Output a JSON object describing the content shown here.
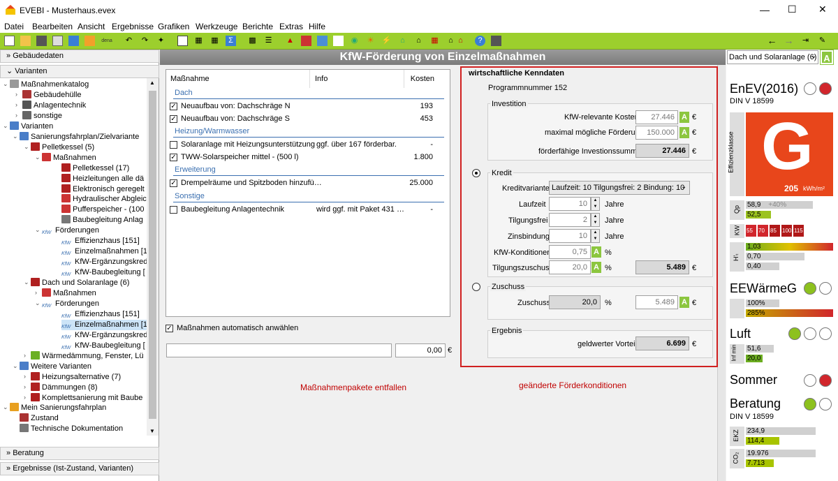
{
  "app": {
    "title": "EVEBI - Musterhaus.evex"
  },
  "menu": [
    "Datei",
    "Bearbeiten",
    "Ansicht",
    "Ergebnisse",
    "Grafiken",
    "Werkzeuge",
    "Berichte",
    "Extras",
    "Hilfe"
  ],
  "toolbar": {
    "dena_label": "dena"
  },
  "left": {
    "gebaeudedaten": "Gebäudedaten",
    "varianten": "Varianten",
    "beratung": "Beratung",
    "ergebnisse": "Ergebnisse (Ist-Zustand, Varianten)",
    "tree": [
      "Maßnahmenkatalog",
      "Gebäudehülle",
      "Anlagentechnik",
      "sonstige",
      "Varianten",
      "Sanierungsfahrplan/Zielvariante",
      "Pelletkessel (5)",
      "Maßnahmen",
      "Pelletkessel (17)",
      "Heizleitungen alle dä",
      "Elektronisch geregelt",
      "Hydraulischer Abgleic",
      "Pufferspeicher - (100",
      "Baubegleitung Anlag",
      "Förderungen",
      "Effizienzhaus [151]",
      "Einzelmaßnahmen [1",
      "KfW-Ergänzungskred",
      "KfW-Baubegleitung [",
      "Dach und Solaranlage (6)",
      "Maßnahmen",
      "Förderungen",
      "Effizienzhaus [151]",
      "Einzelmaßnahmen [1",
      "KfW-Ergänzungskred",
      "KfW-Baubegleitung [",
      "Wärmedämmung, Fenster, Lü",
      "Weitere Varianten",
      "Heizungsalternative (7)",
      "Dämmungen (8)",
      "Komplettsanierung mit Baube",
      "Mein Sanierungsfahrplan",
      "Zustand",
      "Technische Dokumentation"
    ],
    "kfw_tag": "KfW"
  },
  "center": {
    "title": "KfW-Förderung von Einzelmaßnahmen",
    "list_headers": {
      "massnahme": "Maßnahme",
      "info": "Info",
      "kosten": "Kosten"
    },
    "groups": [
      {
        "name": "Dach",
        "items": [
          {
            "label": "Neuaufbau von: Dachschräge N",
            "info": "",
            "cost": "193",
            "checked": true
          },
          {
            "label": "Neuaufbau von: Dachschräge S",
            "info": "",
            "cost": "453",
            "checked": true
          }
        ]
      },
      {
        "name": "Heizung/Warmwasser",
        "items": [
          {
            "label": "Solaranlage mit Heizungsunterstützung",
            "info": "ggf. über 167 förderbar.",
            "cost": "-",
            "checked": false
          },
          {
            "label": "TWW-Solarspeicher mittel - (500 l)",
            "info": "",
            "cost": "1.800",
            "checked": true
          }
        ]
      },
      {
        "name": "Erweiterung",
        "items": [
          {
            "label": "Drempelräume und Spitzboden hinzufü…",
            "info": "",
            "cost": "25.000",
            "checked": true
          }
        ]
      },
      {
        "name": "Sonstige",
        "items": [
          {
            "label": "Baubegleitung Anlagentechnik",
            "info": "wird ggf. mit Paket 431 …",
            "cost": "-",
            "checked": false
          }
        ]
      }
    ],
    "auto_select_label": "Maßnahmen automatisch anwählen",
    "sum_value": "0,00",
    "euro": "€",
    "note_left": "Maßnahmenpakete entfallen",
    "note_right": "geänderte Förderkonditionen",
    "kenn": {
      "title": "wirtschaftliche Kenndaten",
      "programm": "Programmnummer 152",
      "investition_legend": "Investition",
      "kfw_kosten_label": "KfW-relevante Kosten",
      "kfw_kosten_value": "27.446",
      "max_foerderung_label": "maximal mögliche Förderung",
      "max_foerderung_value": "150.000",
      "foerderfaehig_label": "förderfähige Investionssumme",
      "foerderfaehig_value": "27.446",
      "kredit_legend": "Kredit",
      "kreditvariante_label": "Kreditvariante",
      "kreditvariante_value": "Laufzeit: 10 Tilgungsfrei: 2 Bindung: 10",
      "laufzeit_label": "Laufzeit",
      "laufzeit_value": "10",
      "tilgungsfrei_label": "Tilgungsfrei",
      "tilgungsfrei_value": "2",
      "zinsbindung_label": "Zinsbindung",
      "zinsbindung_value": "10",
      "jahre": "Jahre",
      "konditionen_label": "KfW-Konditionen",
      "konditionen_value": "0,75",
      "tilgungszuschuss_label": "Tilgungszuschuss",
      "tilgungszuschuss_value": "20,0",
      "tilgungszuschuss_result": "5.489",
      "percent": "%",
      "zuschuss_legend": "Zuschuss",
      "zuschuss_label": "Zuschuss",
      "zuschuss_value": "20,0",
      "zuschuss_result": "5.489",
      "ergebnis_legend": "Ergebnis",
      "geldwert_label": "geldwerter Vorteil",
      "geldwert_value": "6.699"
    }
  },
  "right": {
    "dropdown": "Dach und Solaranlage (6)",
    "enev_title": "EnEV(2016)",
    "din1": "DIN V 18599",
    "effizienz_label": "Effizienzklasse",
    "grade": "G",
    "kwh": "205",
    "kwh_unit": "kWh/m²",
    "qp_label": "Qp",
    "qp_bar1": "58,9",
    "qp_pct": "+40%",
    "qp_bar2": "52,5",
    "kw_label": "KW",
    "kw_values": [
      "55",
      "70",
      "85",
      "100",
      "115"
    ],
    "ht_label": "H'ₜ",
    "ht_values": [
      "1,03",
      "0,70",
      "0,40"
    ],
    "eew_title": "EEWärmeG",
    "eew_values": [
      "100%",
      "285%"
    ],
    "luft_title": "Luft",
    "infmin_label": "Inf min",
    "luft_values": [
      "51,6",
      "20,0"
    ],
    "sommer_title": "Sommer",
    "beratung_title": "Beratung",
    "din2": "DIN V 18599",
    "ekz_label": "EKZ",
    "ekz_values": [
      "234,9",
      "114,4"
    ],
    "co2_label": "CO₂",
    "co2_values": [
      "19.976",
      "7.713"
    ],
    "colors": {
      "green": "#8dc11e",
      "red": "#d1262c",
      "orange": "#e8461b"
    }
  }
}
